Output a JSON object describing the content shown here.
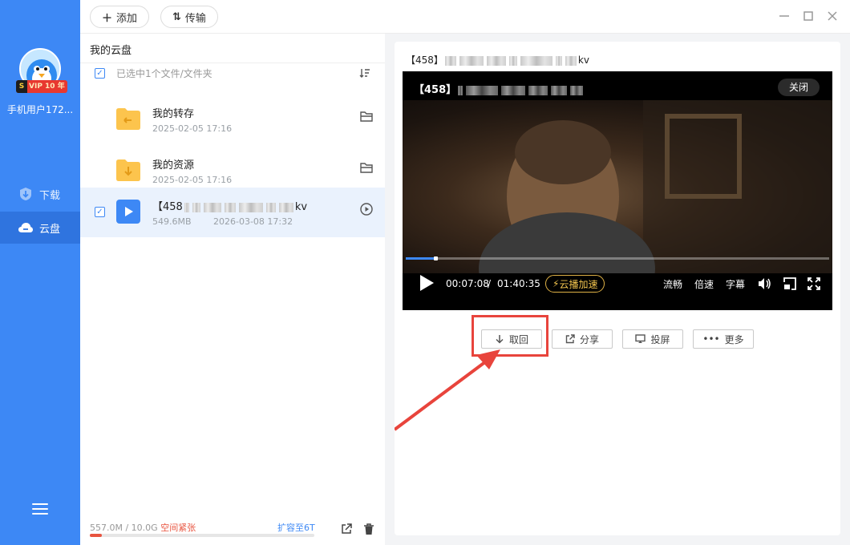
{
  "sidebar": {
    "vip_label": "VIP 10 年",
    "vip_s": "S",
    "username": "手机用户172...",
    "nav": [
      {
        "label": "下载",
        "icon": "download-icon"
      },
      {
        "label": "云盘",
        "icon": "cloud-icon"
      }
    ]
  },
  "topbar": {
    "add_label": "添加",
    "transfer_label": "传输"
  },
  "left": {
    "breadcrumb": "我的云盘",
    "selection_text": "已选中1个文件/文件夹",
    "files": [
      {
        "name": "我的转存",
        "date": "2025-02-05 17:16",
        "type": "folder"
      },
      {
        "name": "我的资源",
        "date": "2025-02-05 17:16",
        "type": "folder"
      },
      {
        "name_prefix": "【458",
        "name_suffix": "kv",
        "size": "549.6MB",
        "date": "2026-03-08 17:32",
        "type": "video",
        "selected": true
      }
    ],
    "storage": {
      "used_text": "557.0M / 10.0G",
      "warning_text": "空间紧张",
      "expand_text": "扩容至6T",
      "used_fraction": 0.054
    }
  },
  "player": {
    "file_title_prefix": "【458】",
    "file_title_suffix": "kv",
    "video_title_prefix": "【458】",
    "close_label": "关闭",
    "current_time": "00:07:08",
    "time_sep": "/",
    "total_time": "01:40:35",
    "progress_fraction": 0.071,
    "boost_label": "云播加速",
    "smooth_label": "流畅",
    "speed_label": "倍速",
    "subs_label": "字幕"
  },
  "actions": {
    "get_label": "取回",
    "share_label": "分享",
    "cast_label": "投屏",
    "more_label": "更多"
  },
  "colors": {
    "accent": "#3d88f5",
    "warning": "#e8543f",
    "highlight": "#e8443c"
  }
}
